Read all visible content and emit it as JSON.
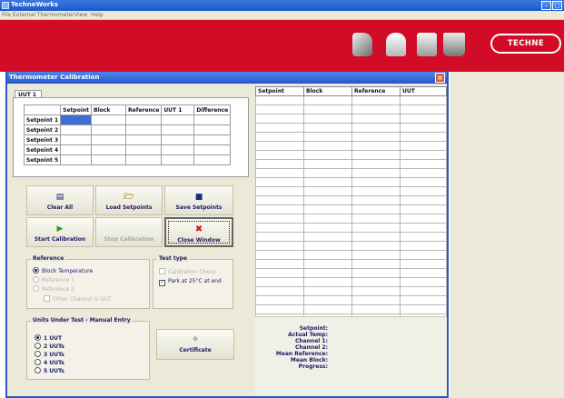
{
  "app": {
    "title": "TechneWorks",
    "menu": [
      "File",
      "External Thermometer",
      "View",
      "Help"
    ],
    "brand": "TECHNE",
    "colors": {
      "banner": "#d20c26",
      "titlebar": "#2457cc"
    }
  },
  "window": {
    "title": "Thermometer Calibration",
    "close_icon": "close-icon"
  },
  "uut_tab": {
    "label": "UUT 1",
    "columns": [
      "",
      "Setpoint",
      "Block",
      "Reference",
      "UUT 1",
      "Difference"
    ],
    "rows": [
      "Setpoint 1",
      "Setpoint 2",
      "Setpoint 3",
      "Setpoint 4",
      "Setpoint 5"
    ]
  },
  "buttons": {
    "clear_all": {
      "label": "Clear All",
      "icon": "clear-icon"
    },
    "load": {
      "label": "Load Setpoints",
      "icon": "folder-icon"
    },
    "save": {
      "label": "Save Setpoints",
      "icon": "floppy-disk-icon"
    },
    "start": {
      "label": "Start Calibration",
      "icon": "play-icon"
    },
    "stop": {
      "label": "Stop Calibration"
    },
    "close": {
      "label": "Close Window",
      "icon": "red-x-icon"
    },
    "certificate": {
      "label": "Certificate",
      "icon": "certificate-icon"
    }
  },
  "reference": {
    "title": "Reference",
    "options": [
      {
        "label": "Block Temperature",
        "selected": true,
        "enabled": true
      },
      {
        "label": "Reference 1",
        "selected": false,
        "enabled": false
      },
      {
        "label": "Reference 2",
        "selected": false,
        "enabled": false
      }
    ],
    "other_channel": "Other Channel is UUT"
  },
  "test_type": {
    "title": "Test type",
    "options": [
      {
        "label": "Calibration Check",
        "enabled": false
      },
      {
        "label": "Park at 25°C at end",
        "enabled": true,
        "checked": true
      }
    ]
  },
  "uut_manual": {
    "title": "Units Under Test - Manual Entry",
    "options": [
      "1 UUT",
      "2 UUTs",
      "3 UUTs",
      "4 UUTs",
      "5 UUTs"
    ],
    "selected_index": 0
  },
  "big_table": {
    "columns": [
      "Setpoint",
      "Block",
      "Reference",
      "UUT"
    ],
    "empty_rows": 25
  },
  "status": {
    "lines": [
      "Setpoint:",
      "Actual Temp:",
      "Channel 1:",
      "Channel 2:",
      "Mean Reference:",
      "Mean Block:",
      "Progress:"
    ]
  }
}
